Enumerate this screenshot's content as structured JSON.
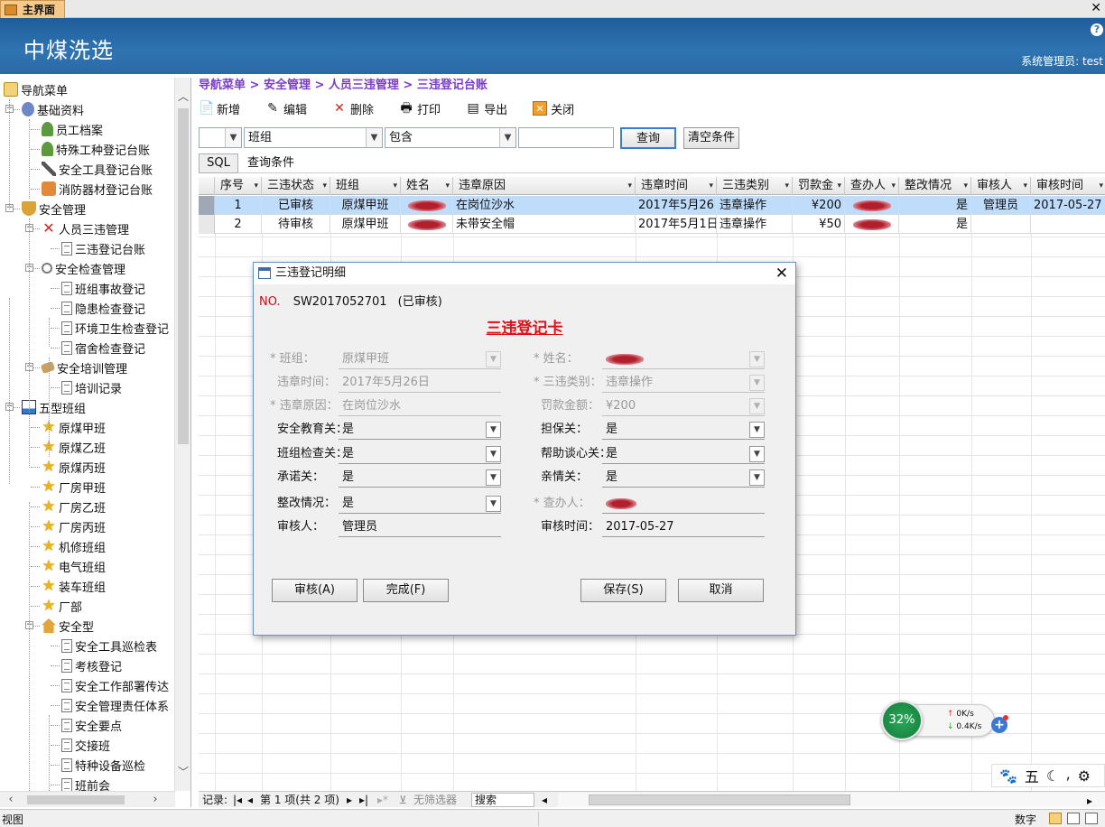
{
  "tab": {
    "title": "主界面"
  },
  "banner": {
    "title": "中煤洗选",
    "user": "系统管理员: test"
  },
  "sidebar": {
    "items": [
      {
        "label": "导航菜单",
        "icon": "folder-icon"
      },
      {
        "label": "基础资料",
        "icon": "users-icon"
      },
      {
        "label": "员工档案",
        "icon": "user-icon"
      },
      {
        "label": "特殊工种登记台账",
        "icon": "user-icon"
      },
      {
        "label": "安全工具登记台账",
        "icon": "tools-icon"
      },
      {
        "label": "消防器材登记台账",
        "icon": "fire-extinguisher-icon"
      },
      {
        "label": "安全管理",
        "icon": "shield-icon"
      },
      {
        "label": "人员三违管理",
        "icon": "red-x-icon"
      },
      {
        "label": "三违登记台账",
        "icon": "document-icon"
      },
      {
        "label": "安全检查管理",
        "icon": "magnifier-icon"
      },
      {
        "label": "班组事故登记",
        "icon": "document-icon"
      },
      {
        "label": "隐患检查登记",
        "icon": "document-icon"
      },
      {
        "label": "环境卫生检查登记",
        "icon": "document-icon"
      },
      {
        "label": "宿舍检查登记",
        "icon": "document-icon"
      },
      {
        "label": "安全培训管理",
        "icon": "training-icon"
      },
      {
        "label": "培训记录",
        "icon": "document-icon"
      },
      {
        "label": "五型班组",
        "icon": "chart-icon"
      },
      {
        "label": "原煤甲班",
        "icon": "star-icon"
      },
      {
        "label": "原煤乙班",
        "icon": "star-icon"
      },
      {
        "label": "原煤丙班",
        "icon": "star-icon"
      },
      {
        "label": "厂房甲班",
        "icon": "star-icon"
      },
      {
        "label": "厂房乙班",
        "icon": "star-icon"
      },
      {
        "label": "厂房丙班",
        "icon": "star-icon"
      },
      {
        "label": "机修班组",
        "icon": "star-icon"
      },
      {
        "label": "电气班组",
        "icon": "star-icon"
      },
      {
        "label": "装车班组",
        "icon": "star-icon"
      },
      {
        "label": "厂部",
        "icon": "star-icon"
      },
      {
        "label": "安全型",
        "icon": "house-icon"
      },
      {
        "label": "安全工具巡检表",
        "icon": "document-icon"
      },
      {
        "label": "考核登记",
        "icon": "document-icon"
      },
      {
        "label": "安全工作部署传达",
        "icon": "document-icon"
      },
      {
        "label": "安全管理责任体系",
        "icon": "document-icon"
      },
      {
        "label": "安全要点",
        "icon": "document-icon"
      },
      {
        "label": "交接班",
        "icon": "document-icon"
      },
      {
        "label": "特种设备巡检",
        "icon": "document-icon"
      },
      {
        "label": "班前会",
        "icon": "document-icon"
      }
    ]
  },
  "breadcrumb": "导航菜单 > 安全管理 > 人员三违管理 > 三违登记台账",
  "toolbar": {
    "add": "新增",
    "edit": "编辑",
    "delete": "删除",
    "print": "打印",
    "export": "导出",
    "close": "关闭"
  },
  "filters": {
    "field": "班组",
    "operator": "包含",
    "value": "",
    "query": "查询",
    "clear": "清空条件"
  },
  "sql": {
    "button": "SQL",
    "condition": "查询条件"
  },
  "grid": {
    "columns": [
      "序号",
      "三违状态",
      "班组",
      "姓名",
      "违章原因",
      "违章时间",
      "三违类别",
      "罚款金",
      "查办人",
      "整改情况",
      "审核人",
      "审核时间"
    ],
    "rows": [
      {
        "no": "1",
        "status": "已审核",
        "team": "原煤甲班",
        "reason": "在岗位沙水",
        "time": "2017年5月26日",
        "category": "违章操作",
        "fine": "¥200",
        "fixed": "是",
        "reviewer": "管理员",
        "review_time": "2017-05-27"
      },
      {
        "no": "2",
        "status": "待审核",
        "team": "原煤甲班",
        "reason": "未带安全帽",
        "time": "2017年5月1日",
        "category": "违章操作",
        "fine": "¥50",
        "fixed": "是",
        "reviewer": "",
        "review_time": ""
      }
    ]
  },
  "recnav": {
    "label": "记录:",
    "position": "第 1 项(共 2 项)",
    "filter": "无筛选器",
    "search": "搜索"
  },
  "dialog": {
    "title": "三违登记明细",
    "no_label": "NO.",
    "no_value": "SW2017052701",
    "no_status": "(已审核)",
    "heading": "三违登记卡",
    "fields": {
      "team_label": "* 班组：",
      "team": "原煤甲班",
      "name_label": "* 姓名：",
      "time_label": "违章时间：",
      "time": "2017年5月26日",
      "category_label": "* 三违类别：",
      "category": "违章操作",
      "reason_label": "* 违章原因：",
      "reason": "在岗位沙水",
      "fine_label": "罚款金额：",
      "fine": "¥200",
      "edu_label": "安全教育关：",
      "edu": "是",
      "guarantee_label": "担保关：",
      "guarantee": "是",
      "teamcheck_label": "班组检查关：",
      "teamcheck": "是",
      "help_label": "帮助谈心关：",
      "help": "是",
      "promise_label": "承诺关：",
      "promise": "是",
      "family_label": "亲情关：",
      "family": "是",
      "fix_label": "整改情况：",
      "fix": "是",
      "handler_label": "* 查办人：",
      "reviewer_label": "审核人：",
      "reviewer": "管理员",
      "review_time_label": "审核时间：",
      "review_time": "2017-05-27"
    },
    "buttons": {
      "audit": "审核(A)",
      "done": "完成(F)",
      "save": "保存(S)",
      "cancel": "取消"
    }
  },
  "speed": {
    "percent": "32%",
    "up": "0K/s",
    "down": "0.4K/s"
  },
  "ime": {
    "char": "五"
  },
  "status": {
    "left": "视图",
    "mode": "数字"
  }
}
